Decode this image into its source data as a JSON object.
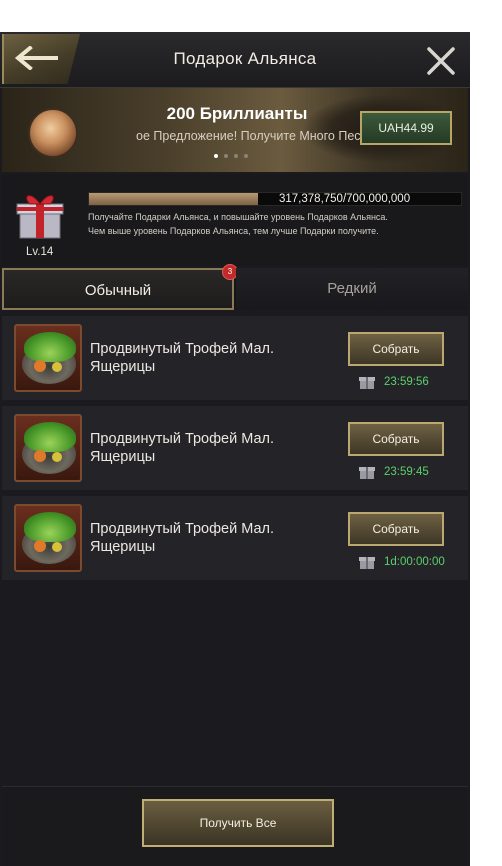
{
  "header": {
    "title": "Подарок Альянса"
  },
  "banner": {
    "title": "200 Бриллианты",
    "subtitle": "ое Предложение! Получите Много Песк",
    "price": "UAH44.99",
    "dots_total": 4,
    "active_dot": 0
  },
  "gift": {
    "level": "Lv.14",
    "progress_text": "317,378,750/700,000,000",
    "progress_fraction": 0.453,
    "description_line1": "Получайте Подарки Альянса, и повышайте уровень Подарков Альянса.",
    "description_line2": "Чем выше уровень Подарков Альянса, тем лучше Подарки получите."
  },
  "tabs": {
    "normal": "Обычный",
    "normal_badge": "3",
    "rare": "Редкий"
  },
  "items": [
    {
      "name": "Продвинутый Трофей Мал. Ящерицы",
      "button": "Собрать",
      "timer": "23:59:56"
    },
    {
      "name": "Продвинутый Трофей Мал. Ящерицы",
      "button": "Собрать",
      "timer": "23:59:45"
    },
    {
      "name": "Продвинутый Трофей Мал. Ящерицы",
      "button": "Собрать",
      "timer": "1d:00:00:00"
    }
  ],
  "footer": {
    "collect_all": "Получить Все"
  },
  "colors": {
    "accent_gold": "#bba870",
    "timer_green": "#5bd26a",
    "badge_red": "#c22a2a",
    "panel_bg": "#1b1a1e"
  }
}
